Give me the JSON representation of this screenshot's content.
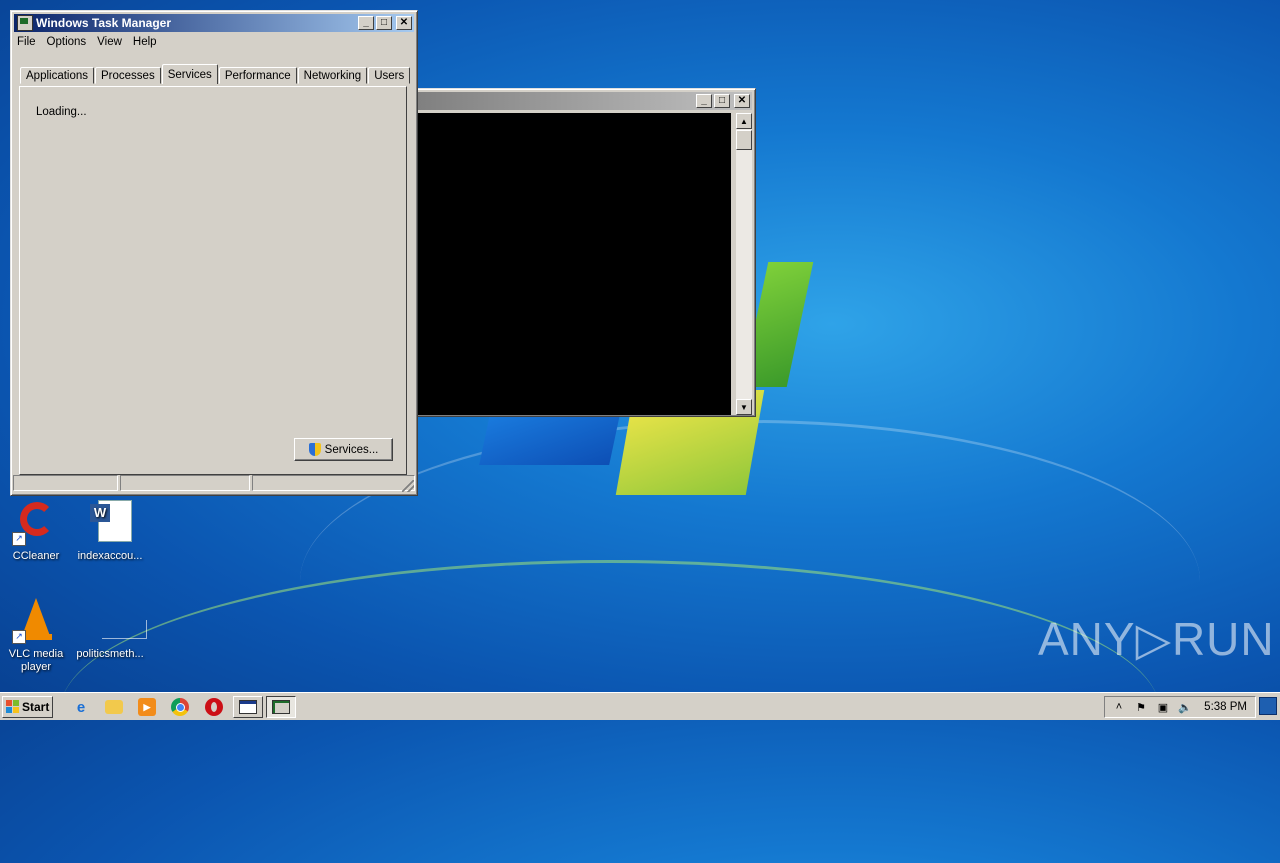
{
  "desktop": {
    "icons": [
      {
        "label": "CCleaner",
        "icon": "ccleaner-icon"
      },
      {
        "label": "indexaccou...",
        "icon": "word-document-icon"
      },
      {
        "label": "VLC media player",
        "icon": "vlc-icon"
      },
      {
        "label": "politicsmeth...",
        "icon": "blank-file-icon"
      }
    ],
    "watermark": "ANY▷RUN"
  },
  "task_manager": {
    "title": "Windows Task Manager",
    "title_buttons": {
      "minimize": "_",
      "maximize": "□",
      "close": "✕"
    },
    "menu": [
      "File",
      "Options",
      "View",
      "Help"
    ],
    "tabs": [
      "Applications",
      "Processes",
      "Services",
      "Performance",
      "Networking",
      "Users"
    ],
    "active_tab": "Services",
    "loading_text": "Loading...",
    "services_button": "Services..."
  },
  "console_window": {
    "title": "",
    "title_buttons": {
      "minimize": "_",
      "maximize": "□",
      "close": "✕"
    },
    "scroll_up": "▲",
    "scroll_down": "▼"
  },
  "taskbar": {
    "start_label": "Start",
    "quick_launch": [
      "internet-explorer-icon",
      "folder-icon",
      "media-player-icon",
      "chrome-icon",
      "opera-icon"
    ],
    "clock": "5:38 PM",
    "tray_icons": [
      "show-hidden-icons-icon",
      "action-center-flag-icon",
      "network-icon",
      "volume-icon"
    ]
  },
  "colors": {
    "titlebar_active": "#0a246a",
    "window_face": "#d4d0c8",
    "desktop": "#1478d0"
  }
}
